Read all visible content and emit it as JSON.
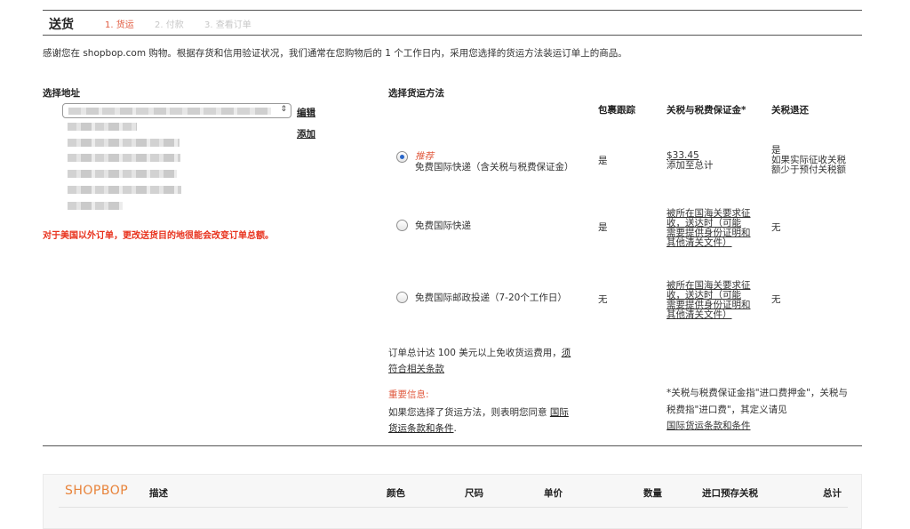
{
  "header": {
    "title": "送货",
    "steps": [
      "1. 货运",
      "2. 付款",
      "3. 查看订单"
    ]
  },
  "intro": "感谢您在 shopbop.com 购物。根据存货和信用验证状况，我们通常在您购物后的 1 个工作日内，采用您选择的货运方法装运订单上的商品。",
  "address": {
    "heading": "选择地址",
    "edit_label": "编辑",
    "add_label": "添加",
    "warning": "对于美国以外订单，更改送货目的地很能会改变订单总额。"
  },
  "shipping": {
    "heading": "选择货运方法",
    "columns": [
      "包裹跟踪",
      "关税与税费保证金*",
      "关税退还"
    ],
    "options": [
      {
        "recommended": "推荐",
        "label": "免费国际快递（含关税与税费保证金）",
        "tracking": "是",
        "duty_amount": "$33.45",
        "duty_note": "添加至总计",
        "refund_line1": "是",
        "refund_line2": "如果实际征收关税",
        "refund_line3": "额少于预付关税额",
        "selected": true
      },
      {
        "label": "免费国际快递",
        "tracking": "是",
        "duty_lines": [
          "被所在国海关要求征",
          "收，送达时（可能",
          "需要提供身份证明和",
          "其他清关文件）"
        ],
        "refund": "无",
        "selected": false
      },
      {
        "label": "免费国际邮政投递（7-20个工作日）",
        "tracking": "无",
        "duty_lines": [
          "被所在国海关要求征",
          "收，送达时（可能",
          "需要提供身份证明和",
          "其他清关文件）"
        ],
        "refund": "无",
        "selected": false
      }
    ],
    "free_shipping_text": "订单总计达 100 美元以上免收货运费用，",
    "free_shipping_link1": "须",
    "free_shipping_link2": "符合相关条款",
    "important_label": "重要信息:",
    "agree_text": "如果您选择了货运方法，则表明您同意",
    "agree_link1": "国际",
    "agree_link2": "货运条款和条件",
    "agree_end": ".",
    "footnote_line1": "*关税与税费保证金指\"进口费押金\"，关税与",
    "footnote_line2": "税费指\"进口费\"，其定义请见",
    "footnote_link": "国际货运条款和条件"
  },
  "cart": {
    "logo": "SHOPBOP",
    "columns": [
      "描述",
      "颜色",
      "尺码",
      "单价",
      "数量",
      "进口预存关税",
      "总计"
    ]
  },
  "colors": {
    "accent": "#e05a3f",
    "warning": "#e8311c",
    "logo": "#e8833a",
    "radio_selected": "#2a67c9"
  }
}
